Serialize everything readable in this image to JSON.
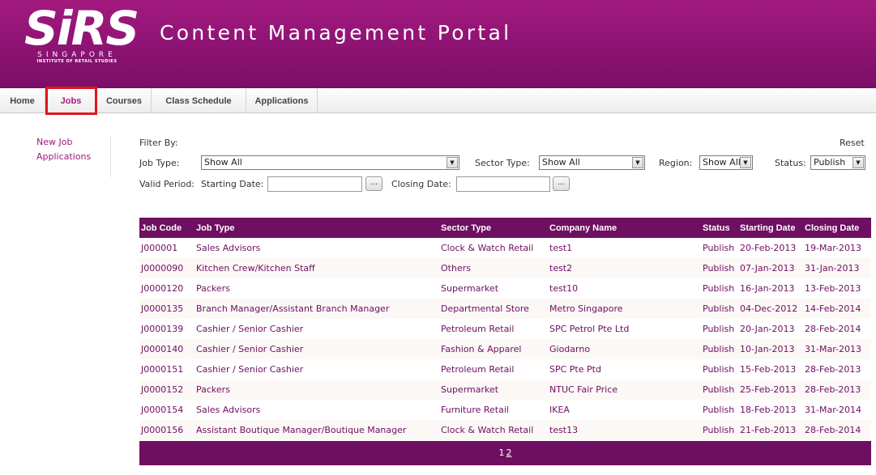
{
  "brand": {
    "logo_text": "SiRS",
    "logo_line1": "SINGAPORE",
    "logo_line2": "INSTITUTE OF RETAIL STUDIES",
    "portal_title": "Content Management Portal"
  },
  "nav": {
    "tabs": [
      {
        "label": "Home"
      },
      {
        "label": "Jobs",
        "active": true
      },
      {
        "label": "Courses"
      },
      {
        "label": "Class Schedule"
      },
      {
        "label": "Applications"
      }
    ]
  },
  "sidebar": {
    "items": [
      {
        "label": "New Job"
      },
      {
        "label": "Applications"
      }
    ]
  },
  "filters": {
    "filter_by": "Filter By:",
    "reset": "Reset",
    "job_type_label": "Job Type:",
    "job_type_value": "Show All",
    "sector_type_label": "Sector Type:",
    "sector_type_value": "Show All",
    "region_label": "Region:",
    "region_value": "Show All",
    "status_label": "Status:",
    "status_value": "Publish",
    "valid_period_label": "Valid Period:",
    "starting_date_label": "Starting Date:",
    "starting_date_value": "",
    "closing_date_label": "Closing Date:",
    "closing_date_value": "",
    "picker_label": "..."
  },
  "table": {
    "columns": [
      "Job Code",
      "Job Type",
      "Sector Type",
      "Company Name",
      "Status",
      "Starting Date",
      "Closing Date"
    ],
    "rows": [
      [
        "J000001",
        "Sales Advisors",
        "Clock & Watch Retail",
        "test1",
        "Publish",
        "20-Feb-2013",
        "19-Mar-2013"
      ],
      [
        "J0000090",
        "Kitchen Crew/Kitchen Staff",
        "Others",
        "test2",
        "Publish",
        "07-Jan-2013",
        "31-Jan-2013"
      ],
      [
        "J0000120",
        "Packers",
        "Supermarket",
        "test10",
        "Publish",
        "16-Jan-2013",
        "13-Feb-2013"
      ],
      [
        "J0000135",
        "Branch Manager/Assistant Branch Manager",
        "Departmental Store",
        "Metro Singapore",
        "Publish",
        "04-Dec-2012",
        "14-Feb-2014"
      ],
      [
        "J0000139",
        "Cashier / Senior Cashier",
        "Petroleum Retail",
        "SPC Petrol Pte Ltd",
        "Publish",
        "20-Jan-2013",
        "28-Feb-2014"
      ],
      [
        "J0000140",
        "Cashier / Senior Cashier",
        "Fashion & Apparel",
        "Giodarno",
        "Publish",
        "10-Jan-2013",
        "31-Mar-2013"
      ],
      [
        "J0000151",
        "Cashier / Senior Cashier",
        "Petroleum Retail",
        "SPC Pte Ptd",
        "Publish",
        "15-Feb-2013",
        "28-Feb-2013"
      ],
      [
        "J0000152",
        "Packers",
        "Supermarket",
        "NTUC Fair Price",
        "Publish",
        "25-Feb-2013",
        "28-Feb-2013"
      ],
      [
        "J0000154",
        "Sales Advisors",
        "Furniture Retail",
        "IKEA",
        "Publish",
        "18-Feb-2013",
        "31-Mar-2014"
      ],
      [
        "J0000156",
        "Assistant Boutique Manager/Boutique Manager",
        "Clock & Watch Retail",
        "test13",
        "Publish",
        "21-Feb-2013",
        "28-Feb-2014"
      ]
    ]
  },
  "pager": {
    "current": "1",
    "next": "2"
  },
  "colors": {
    "brand_purple": "#8d1373",
    "table_header": "#6e0f61",
    "active_tab_outline": "#e0151c"
  }
}
